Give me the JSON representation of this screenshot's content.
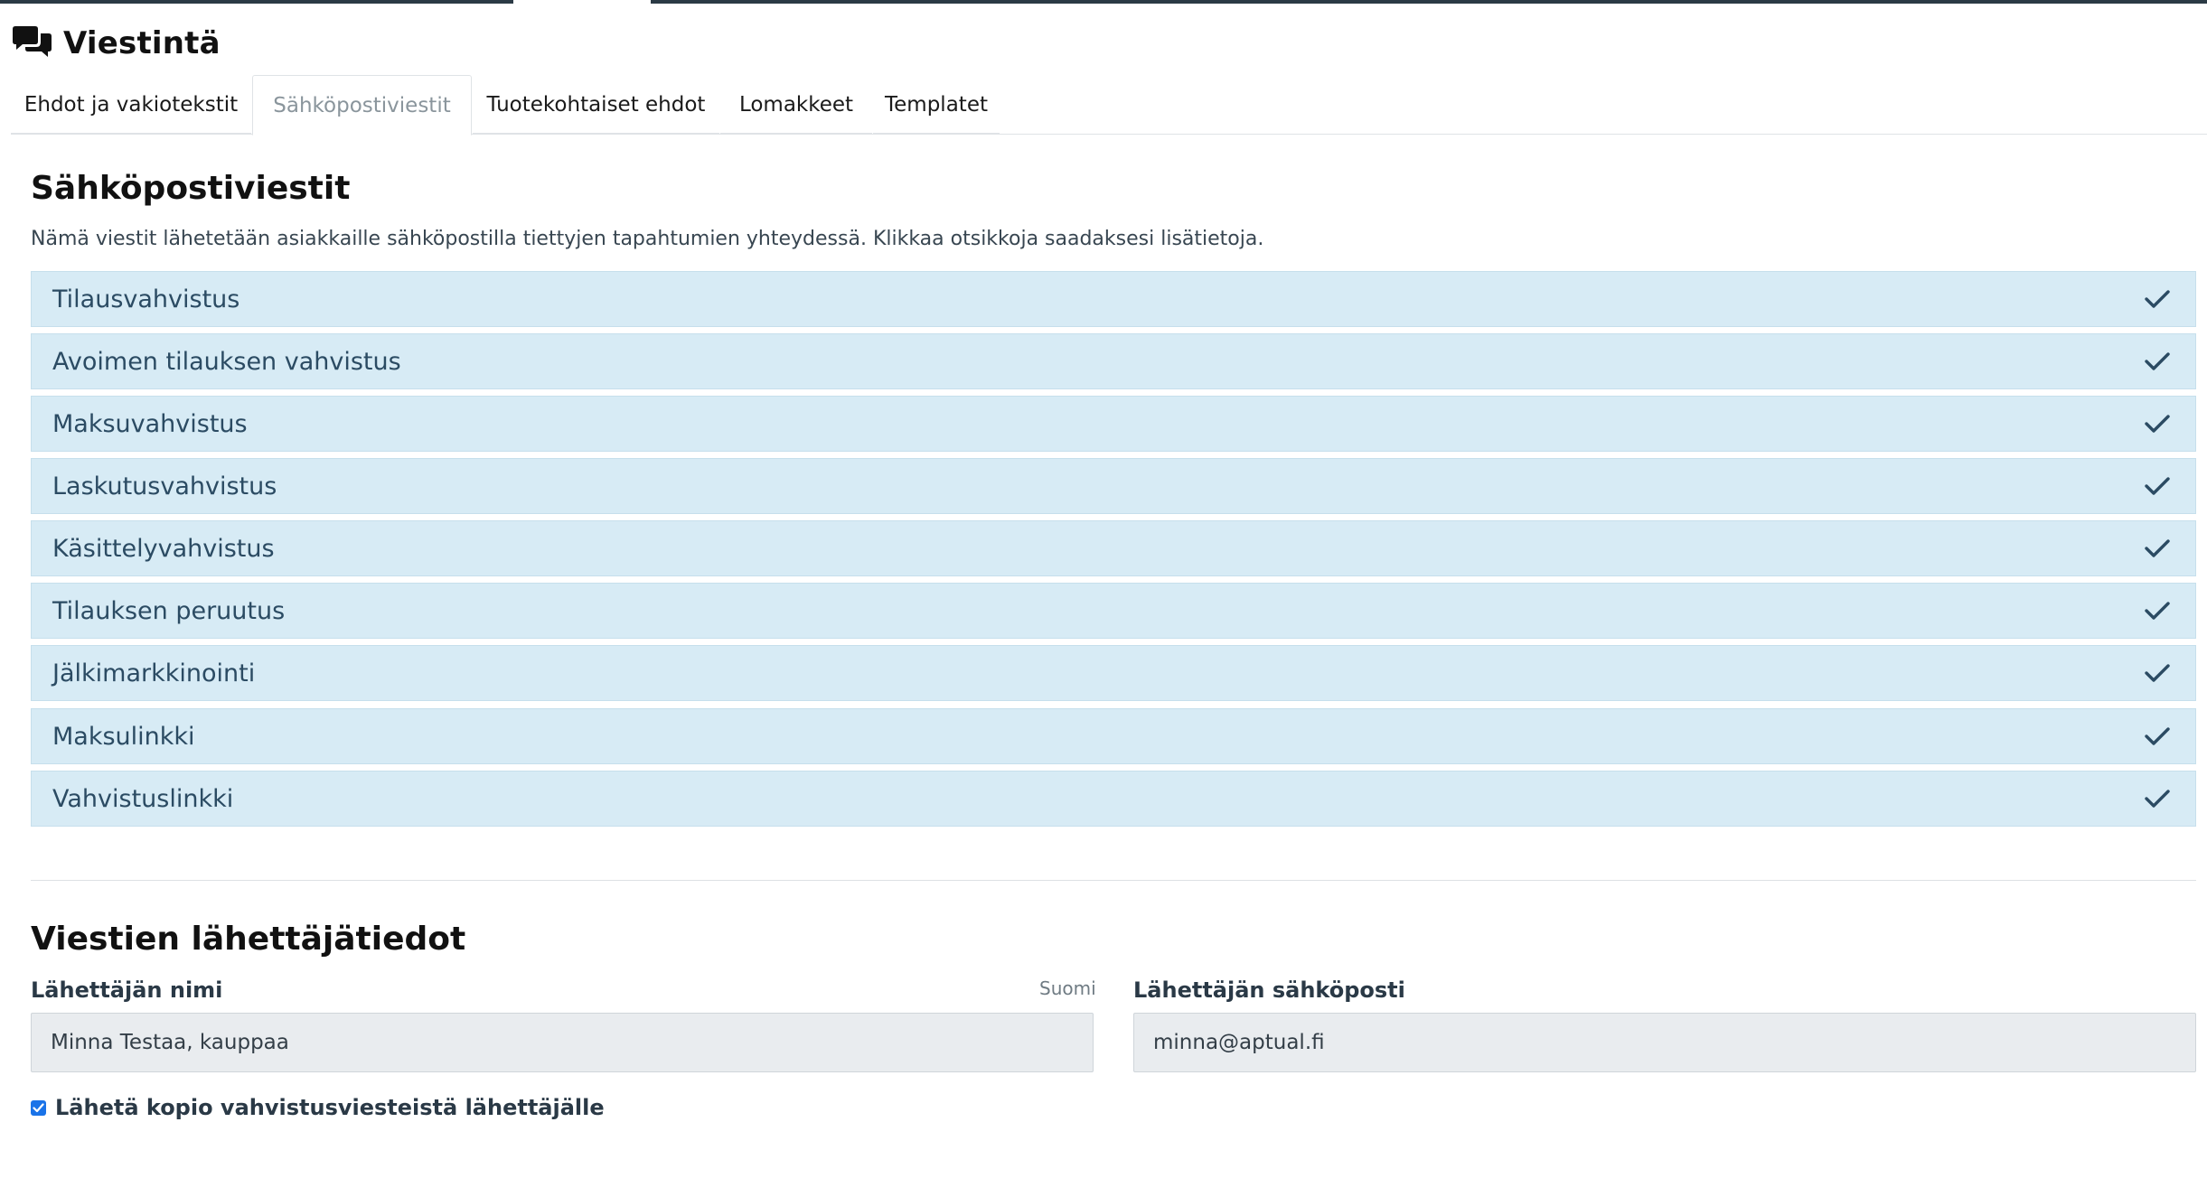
{
  "page": {
    "title": "Viestintä",
    "title_icon": "comments-icon"
  },
  "tabs": [
    {
      "label": "Ehdot ja vakiotekstit",
      "active": false
    },
    {
      "label": "Sähköpostiviestit",
      "active": true
    },
    {
      "label": "Tuotekohtaiset ehdot",
      "active": false
    },
    {
      "label": "Lomakkeet",
      "active": false
    },
    {
      "label": "Templatet",
      "active": false
    }
  ],
  "emails": {
    "heading": "Sähköpostiviestit",
    "description": "Nämä viestit lähetetään asiakkaille sähköpostilla tiettyjen tapahtumien yhteydessä. Klikkaa otsikkoja saadaksesi lisätietoja.",
    "items": [
      {
        "label": "Tilausvahvistus",
        "icon": "check-icon"
      },
      {
        "label": "Avoimen tilauksen vahvistus",
        "icon": "check-icon"
      },
      {
        "label": "Maksuvahvistus",
        "icon": "check-icon"
      },
      {
        "label": "Laskutusvahvistus",
        "icon": "check-icon"
      },
      {
        "label": "Käsittelyvahvistus",
        "icon": "check-icon"
      },
      {
        "label": "Tilauksen peruutus",
        "icon": "check-icon"
      },
      {
        "label": "Jälkimarkkinointi",
        "icon": "check-icon"
      },
      {
        "label": "Maksulinkki",
        "icon": "check-icon"
      },
      {
        "label": "Vahvistuslinkki",
        "icon": "check-icon"
      }
    ]
  },
  "sender": {
    "heading": "Viestien lähettäjätiedot",
    "name_label": "Lähettäjän nimi",
    "name_language": "Suomi",
    "name_value": "Minna Testaa, kauppaa",
    "email_label": "Lähettäjän sähköposti",
    "email_value": "minna@aptual.fi",
    "copy_checkbox_label": "Lähetä kopio vahvistusviesteistä lähettäjälle",
    "copy_checkbox_checked": true
  },
  "colors": {
    "accordion_bg": "#d7ebf5",
    "accordion_text": "#2b4b63",
    "input_bg": "#e9ecef",
    "checkbox_accent": "#1a73e8"
  }
}
